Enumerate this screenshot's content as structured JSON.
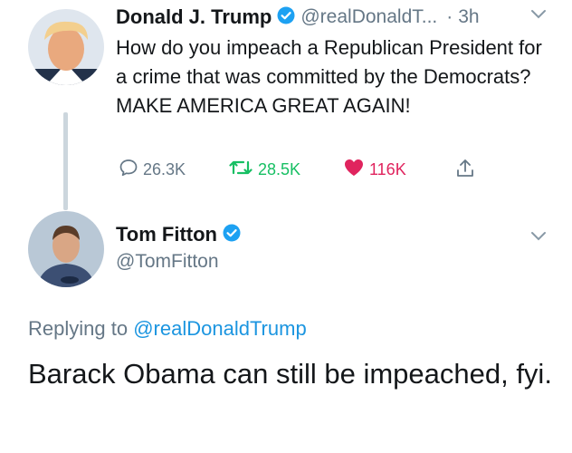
{
  "tweet1": {
    "name": "Donald J. Trump",
    "handle": "@realDonaldT...",
    "separator": "·",
    "time": "3h",
    "text": "How do you impeach a Republican President for a crime that was committed by the Democrats? MAKE AMERICA GREAT AGAIN!",
    "replies": "26.3K",
    "retweets": "28.5K",
    "likes": "116K"
  },
  "tweet2": {
    "name": "Tom Fitton",
    "handle": "@TomFitton",
    "replying_prefix": "Replying to",
    "replying_handle": "@realDonaldTrump",
    "text": "Barack Obama can still be impeached, fyi."
  },
  "colors": {
    "verified": "#1da1f2",
    "link": "#1b95e0",
    "retweet": "#17bf63",
    "like": "#e0245e",
    "muted": "#657786"
  },
  "icons": [
    "verified-badge-icon",
    "chevron-down-icon",
    "reply-icon",
    "retweet-icon",
    "like-icon",
    "share-icon"
  ]
}
